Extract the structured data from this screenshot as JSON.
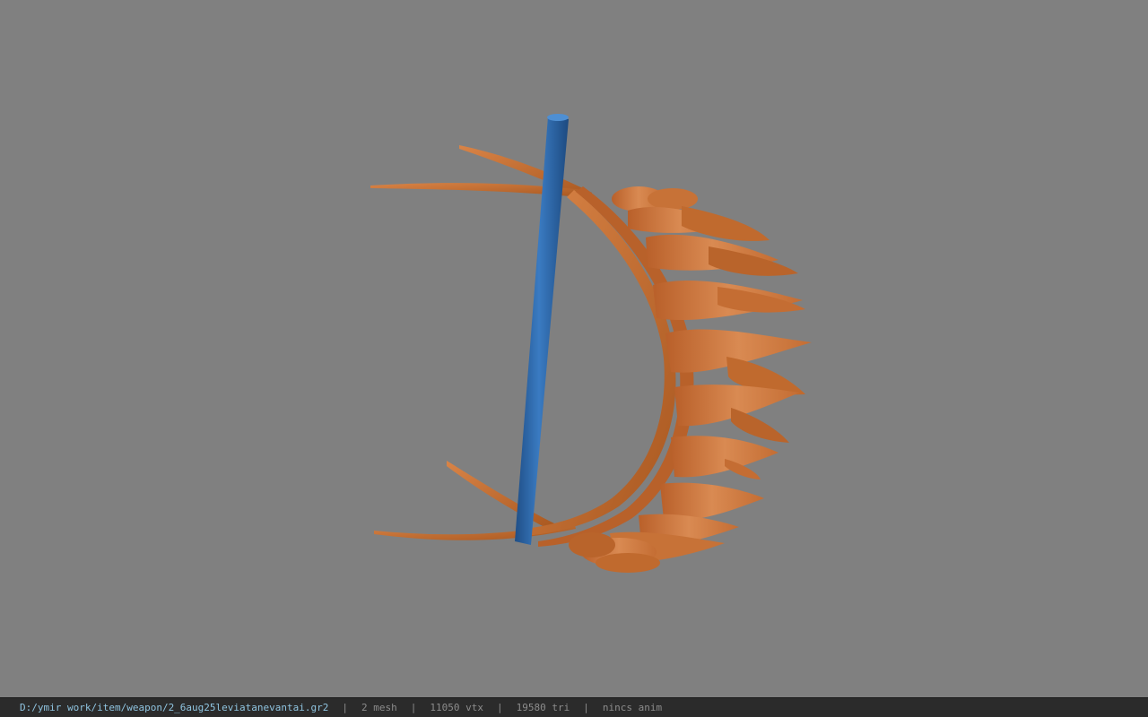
{
  "status": {
    "file_path": "D:/ymir work/item/weapon/2_6aug25leviatanevantai.gr2",
    "mesh": "2 mesh",
    "vtx": "11050 vtx",
    "tri": "19580 tri",
    "anim": "nincs anim",
    "separator": "|"
  },
  "viewport": {
    "background": "#808080",
    "model_color": "#c06a2e",
    "shaft_color": "#2a64a6"
  }
}
